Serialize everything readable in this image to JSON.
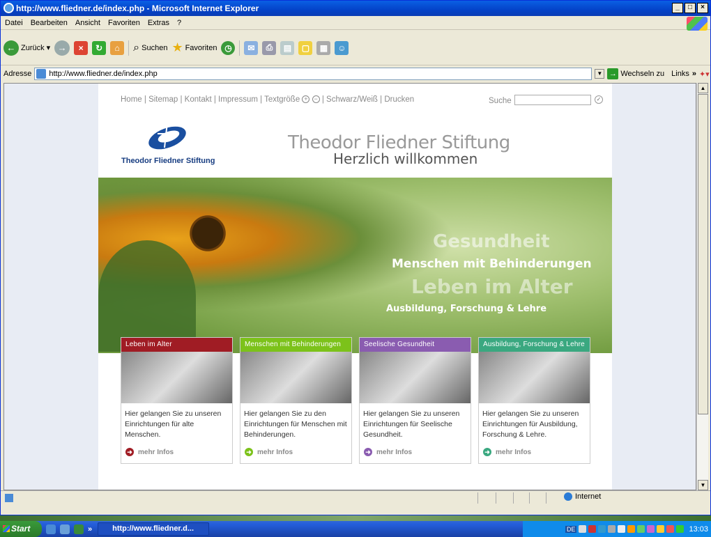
{
  "window": {
    "title": "http://www.fliedner.de/index.php - Microsoft Internet Explorer"
  },
  "menu": [
    "Datei",
    "Bearbeiten",
    "Ansicht",
    "Favoriten",
    "Extras",
    "?"
  ],
  "toolbar": {
    "back": "Zurück",
    "search": "Suchen",
    "favorites": "Favoriten"
  },
  "address": {
    "label": "Adresse",
    "url": "http://www.fliedner.de/index.php",
    "go": "Wechseln zu",
    "links": "Links"
  },
  "site": {
    "nav": [
      "Home",
      "Sitemap",
      "Kontakt",
      "Impressum",
      "Textgröße",
      "Schwarz/Weiß",
      "Drucken"
    ],
    "search_label": "Suche",
    "logo_text": "Theodor Fliedner Stiftung",
    "header_title": "Theodor Fliedner Stiftung",
    "header_sub": "Herzlich willkommen",
    "hero": [
      "Gesundheit",
      "Menschen mit Behinderungen",
      "Leben im Alter",
      "Ausbildung, Forschung & Lehre"
    ],
    "cards": [
      {
        "title": "Leben im Alter",
        "text": "Hier gelangen Sie zu unseren Einrichtungen für alte Menschen.",
        "more": "mehr Infos",
        "color": "#a01c24"
      },
      {
        "title": "Menschen mit Behinderungen",
        "text": "Hier gelangen Sie zu den Einrichtungen für Menschen mit Behinderungen.",
        "more": "mehr Infos",
        "color": "#7cc21a"
      },
      {
        "title": "Seelische Gesundheit",
        "text": "Hier gelangen Sie zu unseren Einrichtungen für Seelische Gesundheit.",
        "more": "mehr Infos",
        "color": "#8a5cb0"
      },
      {
        "title": "Ausbildung, Forschung & Lehre",
        "text": "Hier gelangen Sie zu unseren Einrichtungen für Ausbildung, Forschung & Lehre.",
        "more": "mehr Infos",
        "color": "#3aa880"
      }
    ]
  },
  "status": {
    "zone": "Internet"
  },
  "taskbar": {
    "start": "Start",
    "item": "http://www.fliedner.d...",
    "time": "13:03",
    "lang": "DE"
  }
}
